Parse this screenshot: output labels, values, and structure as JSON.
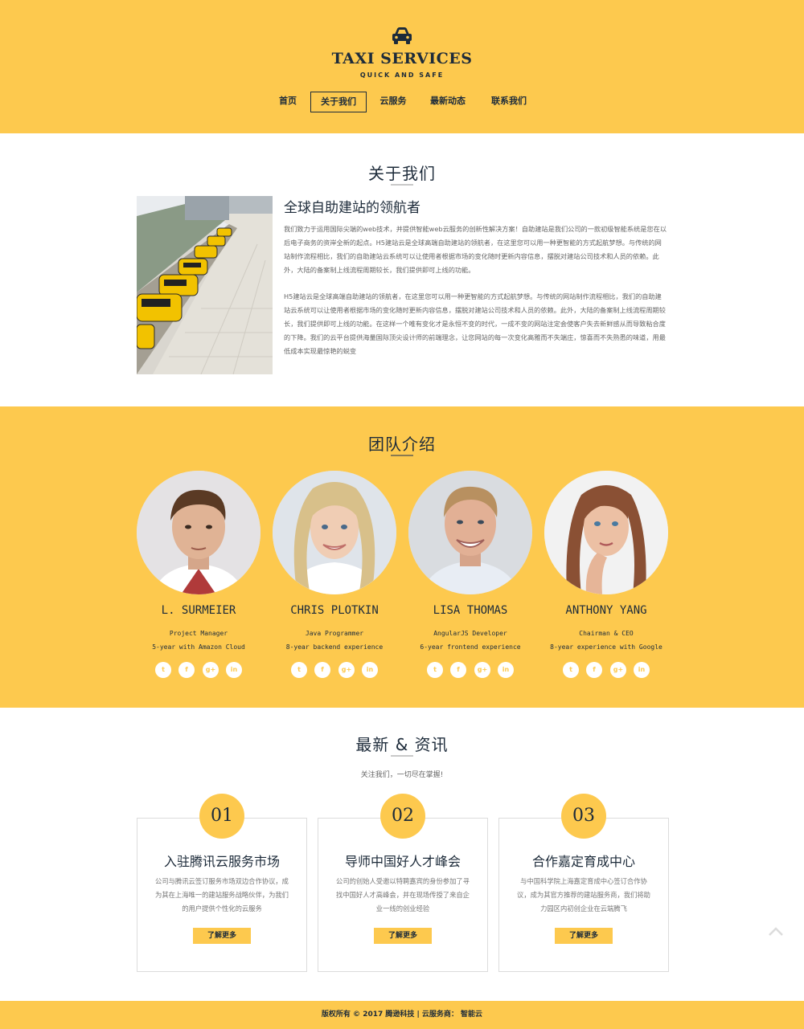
{
  "header": {
    "brand": "TAXI SERVICES",
    "tagline": "QUICK AND SAFE",
    "logo_icon": "taxi-car-icon",
    "nav": [
      {
        "label": "首页",
        "active": false
      },
      {
        "label": "关于我们",
        "active": true
      },
      {
        "label": "云服务",
        "active": false
      },
      {
        "label": "最新动态",
        "active": false
      },
      {
        "label": "联系我们",
        "active": false
      }
    ]
  },
  "about": {
    "title": "关于我们",
    "heading": "全球自助建站的领航者",
    "paragraphs": [
      "我们致力于运用国际尖端的web技术，并提供智能web云服务的创新性解决方案！自助建站是我们公司的一款初级智能系统是您在以后电子商务的资岸全新的起点。H5建站云是全球高端自助建站的领航者，在这里您可以用一种更智能的方式起航梦想。与传统的网站制作流程相比，我们的自助建站云系统可以让使用者根据市场的变化随时更新内容信息，摆脱对建站公司技术和人员的依赖。此外，大陆的备案制上线流程周期较长，我们提供即可上线的功能。",
      "H5建站云是全球高端自助建站的领航者，在这里您可以用一种更智能的方式起航梦想。与传统的网站制作流程相比，我们的自助建站云系统可以让使用者根据市场的变化随时更新内容信息，摆脱对建站公司技术和人员的依赖。此外，大陆的备案制上线流程周期较长，我们提供即可上线的功能。在这样一个唯有变化才是永恒不变的时代，一成不变的网站注定会使客户失去新鲜感从而导致粘合度的下降。我们的云平台提供海量国际顶尖设计师的前端理念，让您网站的每一次变化高雅而不失端庄，惊喜而不失熟悉的味道，用最低成本实现最惊艳的蜕变"
    ]
  },
  "team": {
    "title": "团队介绍",
    "members": [
      {
        "name": "L. SURMEIER",
        "role": "Project Manager",
        "exp": "5-year with Amazon Cloud"
      },
      {
        "name": "CHRIS PLOTKIN",
        "role": "Java Programmer",
        "exp": "8-year backend experience"
      },
      {
        "name": "LISA THOMAS",
        "role": "AngularJS Developer",
        "exp": "6-year frontend experience"
      },
      {
        "name": "ANTHONY YANG",
        "role": "Chairman & CEO",
        "exp": "8-year experience with Google"
      }
    ],
    "socials": [
      {
        "icon": "twitter-icon",
        "glyph": "t"
      },
      {
        "icon": "facebook-icon",
        "glyph": "f"
      },
      {
        "icon": "google-plus-icon",
        "glyph": "g+"
      },
      {
        "icon": "linkedin-icon",
        "glyph": "in"
      }
    ]
  },
  "news": {
    "title": "最新 & 资讯",
    "subtitle": "关注我们，一切尽在掌握!",
    "cards": [
      {
        "num": "01",
        "title": "入驻腾讯云服务市场",
        "text": "公司与腾讯云签订服务市场双边合作协议，成为其在上海唯一的建站服务战略伙伴，为我们的用户提供个性化的云服务",
        "button": "了解更多"
      },
      {
        "num": "02",
        "title": "导师中国好人才峰会",
        "text": "公司的创始人受邀以特聘嘉宾的身份参加了寻找中国好人才高峰会，并在现场传授了来自企业一线的创业经验",
        "button": "了解更多"
      },
      {
        "num": "03",
        "title": "合作嘉定育成中心",
        "text": "与中国科学院上海嘉定育成中心签订合作协议，成为其官方推荐的建站服务商，我们将助力园区内初创企业在云端腾飞",
        "button": "了解更多"
      }
    ]
  },
  "footer": {
    "text": "版权所有 © 2017  腾逊科技  |  云服务商：  智能云"
  },
  "colors": {
    "accent": "#fdc94e",
    "navy": "#1d2b3a"
  }
}
